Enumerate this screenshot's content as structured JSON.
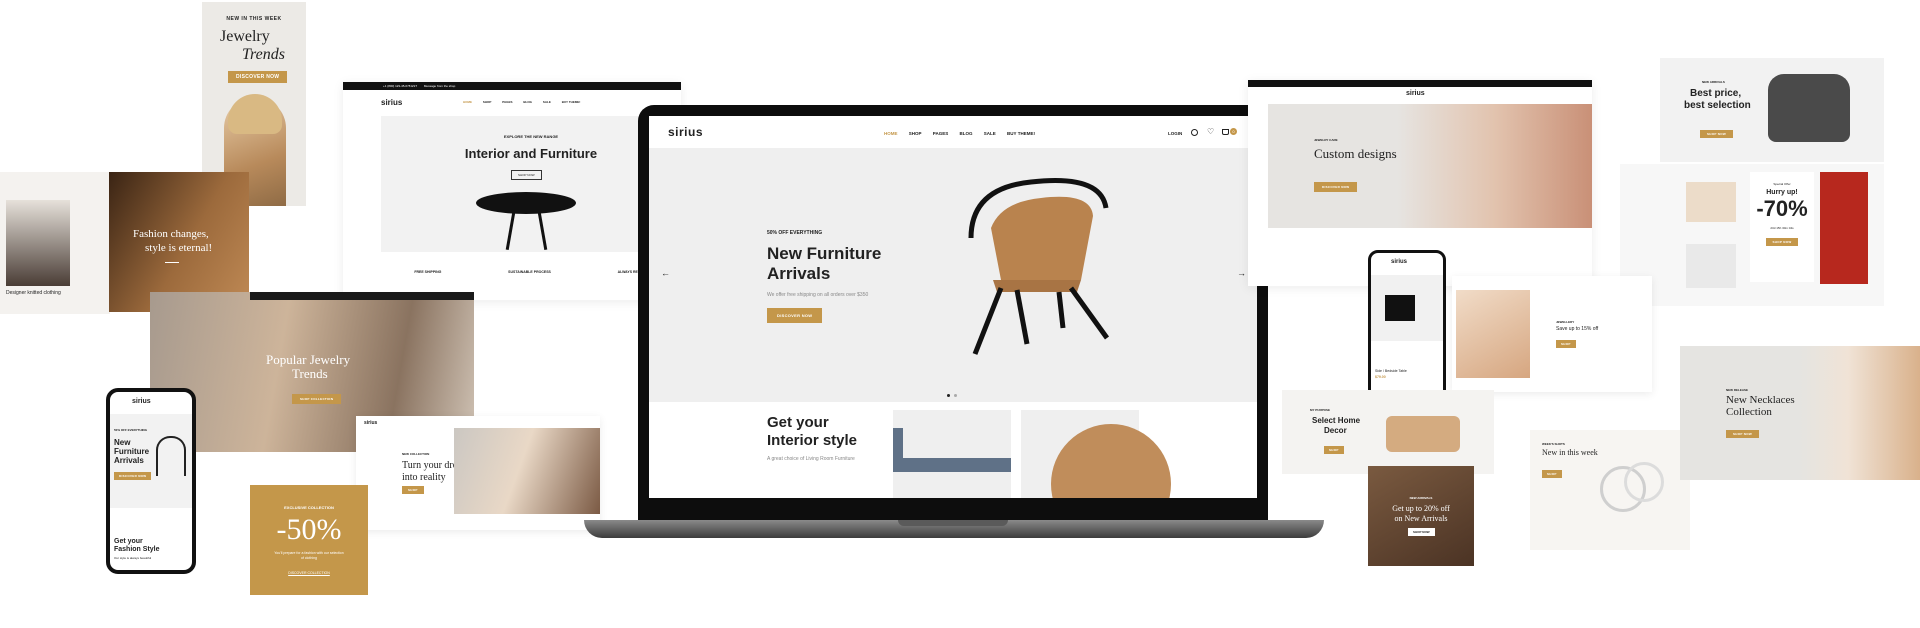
{
  "brand": {
    "name": "sirius",
    "accent": "#c4974a"
  },
  "laptop": {
    "nav": [
      "HOME",
      "SHOP",
      "PAGES",
      "BLOG",
      "SALE",
      "BUY THEME!"
    ],
    "login": "LOGIN",
    "cart_count": "0",
    "kicker": "50% OFF EVERYTHING",
    "title_line1": "New Furniture",
    "title_line2": "Arrivals",
    "subtitle": "We offer free shipping on all orders over $350",
    "cta": "DISCOVER NOW",
    "section_title_line1": "Get your",
    "section_title_line2": "Interior style",
    "section_text": "A great choice of Living Room Furniture"
  },
  "jewelry_trends": {
    "kicker": "NEW IN THIS WEEK",
    "line1": "Jewelry",
    "line2": "Trends",
    "cta": "DISCOVER NOW"
  },
  "interior_site": {
    "topbar": "+1 (800) 123-45-678 EST",
    "topbar_note": "Message from the shop",
    "nav": [
      "HOME",
      "SHOP",
      "PAGES",
      "BLOG",
      "SALE",
      "BUY THEME!"
    ],
    "kicker": "EXPLORE THE NEW RANGE",
    "title": "Interior and Furniture",
    "cta": "SHOP NOW",
    "features": [
      "FREE SHIPPING",
      "SUSTAINABLE PROCESS",
      "ALWAYS RETURN"
    ]
  },
  "fashion_card": {
    "caption": "Designer knitted clothing",
    "line1": "Fashion changes,",
    "line2": "style is eternal!"
  },
  "popular_jewelry": {
    "line1": "Popular Jewelry",
    "line2": "Trends",
    "cta": "SHOP COLLECTION"
  },
  "dream_card": {
    "kicker": "NEW COLLECTION",
    "line1": "Turn your dream",
    "line2": "into reality",
    "cta": "SHOP"
  },
  "sale_card": {
    "kicker": "EXCLUSIVE COLLECTION",
    "value": "-50%",
    "text": "You'll prepare for a fashion with our selection of clothing",
    "cta": "DISCOVER COLLECTION"
  },
  "phone_left": {
    "kicker": "50% OFF EVERYTHING",
    "line1": "New",
    "line2": "Furniture",
    "line3": "Arrivals",
    "cta": "DISCOVER NOW",
    "section_line1": "Get your",
    "section_line2": "Fashion Style",
    "section_text": "Our style is always beautiful"
  },
  "custom_designs": {
    "kicker": "JEWELRY CARE",
    "title": "Custom designs",
    "cta": "DISCOVER NOW"
  },
  "best_price": {
    "kicker": "NEW ARRIVALS",
    "line1": "Best price,",
    "line2": "best selection",
    "cta": "SHOP NOW"
  },
  "hurry_up": {
    "kicker": "Special Offer",
    "line1": "Hurry up!",
    "value": "-70%",
    "timer": [
      "23d",
      "15h",
      "30m",
      "04s"
    ],
    "cta": "SHOP NOW"
  },
  "phone_right": {
    "product": "Side / Bedside Table",
    "price": "$79.00"
  },
  "save_card": {
    "kicker": "JEWELLERY",
    "line1": "Save up to 15% off",
    "cta": "SHOP"
  },
  "home_decor": {
    "kicker": "MY PURPOSE",
    "line1": "Select Home",
    "line2": "Decor",
    "cta": "SHOP"
  },
  "new_arrivals_card": {
    "kicker": "NEW ARRIVALS",
    "line1": "Get up to 20% off",
    "line2": "on New Arrivals",
    "cta": "SHOP NOW"
  },
  "new_week": {
    "kicker": "WEEK'S SHOTS",
    "title": "New in this week",
    "cta": "SHOP"
  },
  "necklaces": {
    "kicker": "NEW RELEASE",
    "line1": "New Necklaces",
    "line2": "Collection",
    "cta": "SHOP NOW"
  }
}
